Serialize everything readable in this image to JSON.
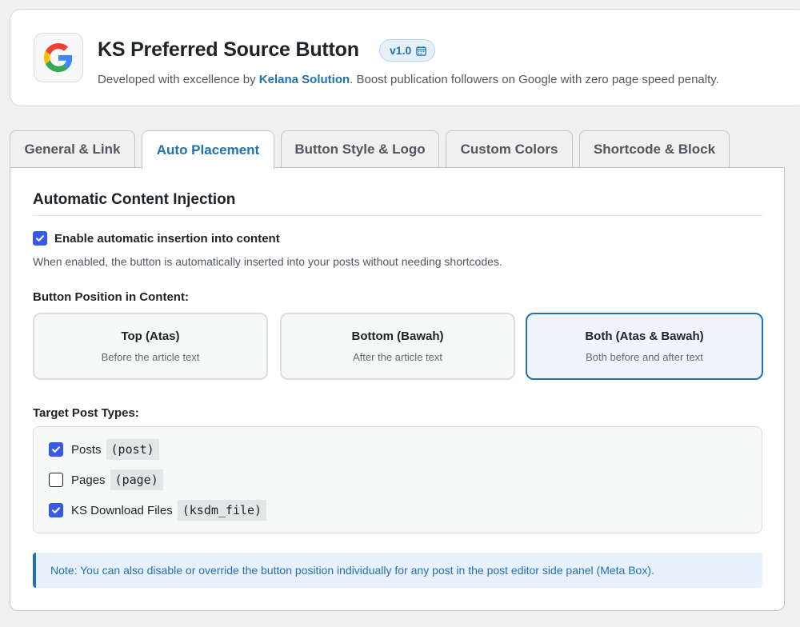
{
  "header": {
    "title": "KS Preferred Source  Button",
    "version": "v1.0",
    "subtitle_prefix": "Developed with excellence by ",
    "subtitle_link": "Kelana Solution",
    "subtitle_suffix": ". Boost publication followers on Google with zero page speed penalty.",
    "logo_icon": "google-g-icon",
    "version_icon": "calendar-icon"
  },
  "tabs": [
    {
      "label": "General & Link",
      "active": false
    },
    {
      "label": "Auto Placement",
      "active": true
    },
    {
      "label": "Button Style & Logo",
      "active": false
    },
    {
      "label": "Custom Colors",
      "active": false
    },
    {
      "label": "Shortcode & Block",
      "active": false
    }
  ],
  "section": {
    "title": "Automatic Content Injection",
    "enable": {
      "label": "Enable automatic insertion into content",
      "checked": true,
      "description": "When enabled, the button is automatically inserted into your posts without needing shortcodes."
    },
    "position": {
      "label": "Button Position in Content:",
      "options": [
        {
          "title": "Top (Atas)",
          "desc": "Before the article text",
          "selected": false
        },
        {
          "title": "Bottom (Bawah)",
          "desc": "After the article text",
          "selected": false
        },
        {
          "title": "Both (Atas & Bawah)",
          "desc": "Both before and after text",
          "selected": true
        }
      ]
    },
    "post_types": {
      "label": "Target Post Types:",
      "items": [
        {
          "label": "Posts",
          "slug": "(post)",
          "checked": true
        },
        {
          "label": "Pages",
          "slug": "(page)",
          "checked": false
        },
        {
          "label": "KS Download Files",
          "slug": "(ksdm_file)",
          "checked": true
        }
      ]
    },
    "note": "Note: You can also disable or override the button position individually for any post in the post editor side panel (Meta Box)."
  },
  "colors": {
    "accent": "#2271b1",
    "checkbox": "#3858e9",
    "text": "#1d2327",
    "muted": "#50575e"
  }
}
